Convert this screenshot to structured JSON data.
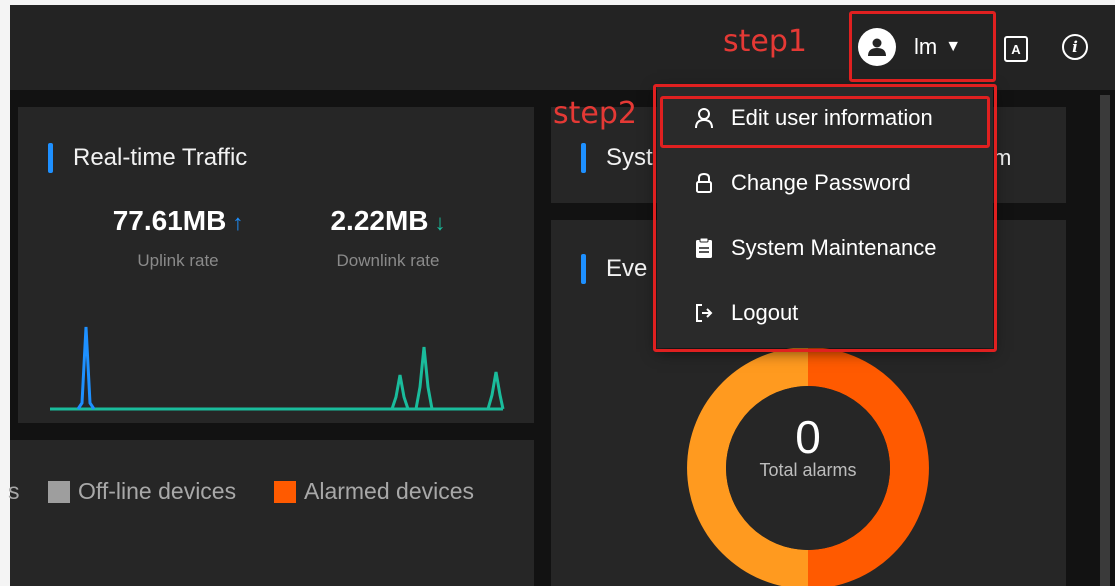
{
  "header": {
    "user_name": "lm",
    "language_icon": "A",
    "info_icon": "i"
  },
  "annotations": {
    "step1": "step1",
    "step2": "step2"
  },
  "user_menu": {
    "items": [
      {
        "label": "Edit user information",
        "icon": "person-icon"
      },
      {
        "label": "Change Password",
        "icon": "lock-icon"
      },
      {
        "label": "System Maintenance",
        "icon": "clipboard-icon"
      },
      {
        "label": "Logout",
        "icon": "logout-icon"
      }
    ]
  },
  "traffic": {
    "title": "Real-time Traffic",
    "uplink": {
      "value": "77.61MB",
      "arrow": "↑",
      "label": "Uplink rate"
    },
    "downlink": {
      "value": "2.22MB",
      "arrow": "↓",
      "label": "Downlink rate"
    }
  },
  "device_legend": {
    "partial": "s",
    "offline": "Off-line devices",
    "alarmed": "Alarmed devices"
  },
  "system_panel": {
    "title_partial": "Syst",
    "tail_partial": "m"
  },
  "event_panel": {
    "title_partial": "Eve",
    "total_alarms_value": "0",
    "total_alarms_label": "Total alarms"
  },
  "colors": {
    "accent_blue": "#1e90ff",
    "uplink": "#1e90ff",
    "downlink": "#1abc9c",
    "annotation_red": "#e53935",
    "offline_gray": "#9e9e9e",
    "alarm_orange": "#ff5a00",
    "donut_light": "#ff9a1f",
    "donut_dark": "#ff5a00"
  }
}
